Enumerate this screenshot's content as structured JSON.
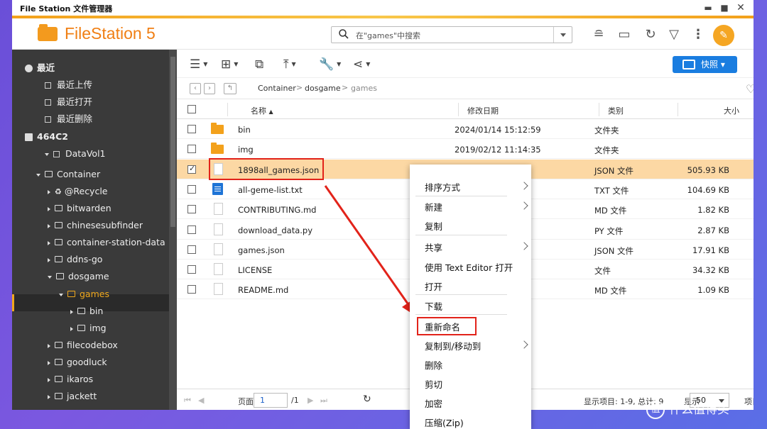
{
  "window": {
    "title": "File Station 文件管理器"
  },
  "app": {
    "name": "FileStation 5"
  },
  "search": {
    "placeholder": "在\"games\"中搜索"
  },
  "toolbar": {
    "snapshot_label": "快照"
  },
  "sidebar": {
    "items": [
      {
        "label": "最近",
        "level": 0,
        "bold": true,
        "icon": "clock-icon"
      },
      {
        "label": "最近上传",
        "level": 1,
        "icon": "list-icon"
      },
      {
        "label": "最近打开",
        "level": 1,
        "icon": "list-icon"
      },
      {
        "label": "最近删除",
        "level": 1,
        "icon": "list-icon"
      },
      {
        "label": "464C2",
        "level": 0,
        "bold": true,
        "icon": "nas-icon"
      },
      {
        "label": "DataVol1",
        "level": 1,
        "icon": "drive-icon"
      },
      {
        "label": "Container",
        "level": 2,
        "icon": "folder-icon"
      },
      {
        "label": "@Recycle",
        "level": 3,
        "icon": "recycle-icon"
      },
      {
        "label": "bitwarden",
        "level": 3,
        "icon": "folder-icon"
      },
      {
        "label": "chinesesubfinder",
        "level": 3,
        "icon": "folder-icon"
      },
      {
        "label": "container-station-data",
        "level": 3,
        "icon": "folder-icon"
      },
      {
        "label": "ddns-go",
        "level": 3,
        "icon": "folder-icon"
      },
      {
        "label": "dosgame",
        "level": 3,
        "icon": "folder-icon"
      },
      {
        "label": "games",
        "level": 4,
        "icon": "folder-icon",
        "selected": true
      },
      {
        "label": "bin",
        "level": 5,
        "icon": "folder-icon"
      },
      {
        "label": "img",
        "level": 5,
        "icon": "folder-icon"
      },
      {
        "label": "filecodebox",
        "level": 3,
        "icon": "folder-icon"
      },
      {
        "label": "goodluck",
        "level": 3,
        "icon": "folder-icon"
      },
      {
        "label": "ikaros",
        "level": 3,
        "icon": "folder-icon"
      },
      {
        "label": "jackett",
        "level": 3,
        "icon": "folder-icon"
      }
    ]
  },
  "breadcrumb": [
    "Container",
    "dosgame",
    "games"
  ],
  "table": {
    "headers": {
      "name": "名称",
      "date": "修改日期",
      "type": "类别",
      "size": "大小"
    },
    "rows": [
      {
        "name": "bin",
        "date": "2024/01/14 15:12:59",
        "type": "文件夹",
        "size": "",
        "icon": "folder"
      },
      {
        "name": "img",
        "date": "2019/02/12 11:14:35",
        "type": "文件夹",
        "size": "",
        "icon": "folder"
      },
      {
        "name": "1898all_games.json",
        "date": "",
        "type": "JSON 文件",
        "size": "505.93 KB",
        "icon": "file",
        "selected": true
      },
      {
        "name": "all-geme-list.txt",
        "date": "",
        "type": "TXT 文件",
        "size": "104.69 KB",
        "icon": "txt"
      },
      {
        "name": "CONTRIBUTING.md",
        "date": "",
        "type": "MD 文件",
        "size": "1.82 KB",
        "icon": "file"
      },
      {
        "name": "download_data.py",
        "date": "",
        "type": "PY 文件",
        "size": "2.87 KB",
        "icon": "file"
      },
      {
        "name": "games.json",
        "date": "",
        "type": "JSON 文件",
        "size": "17.91 KB",
        "icon": "file"
      },
      {
        "name": "LICENSE",
        "date": "",
        "type": "文件",
        "size": "34.32 KB",
        "icon": "file"
      },
      {
        "name": "README.md",
        "date": "",
        "type": "MD 文件",
        "size": "1.09 KB",
        "icon": "file"
      }
    ]
  },
  "footer": {
    "page_label": "页面",
    "page_value": "1",
    "page_total": "/1",
    "items_info": "显示项目: 1-9, 总计: 9",
    "show_label": "显示",
    "show_value": "50",
    "items_label": "项目"
  },
  "context_menu": {
    "items": [
      "排序方式",
      "新建",
      "复制",
      "共享",
      "使用 Text Editor 打开",
      "打开",
      "下载",
      "重新命名",
      "复制到/移动到",
      "删除",
      "剪切",
      "加密",
      "压缩(Zip)"
    ]
  },
  "watermark": {
    "text": "什么值得买"
  },
  "colors": {
    "accent": "#f07f14",
    "primary": "#1a7de0",
    "selection": "#fcd8a4",
    "highlight": "#e2231a"
  }
}
